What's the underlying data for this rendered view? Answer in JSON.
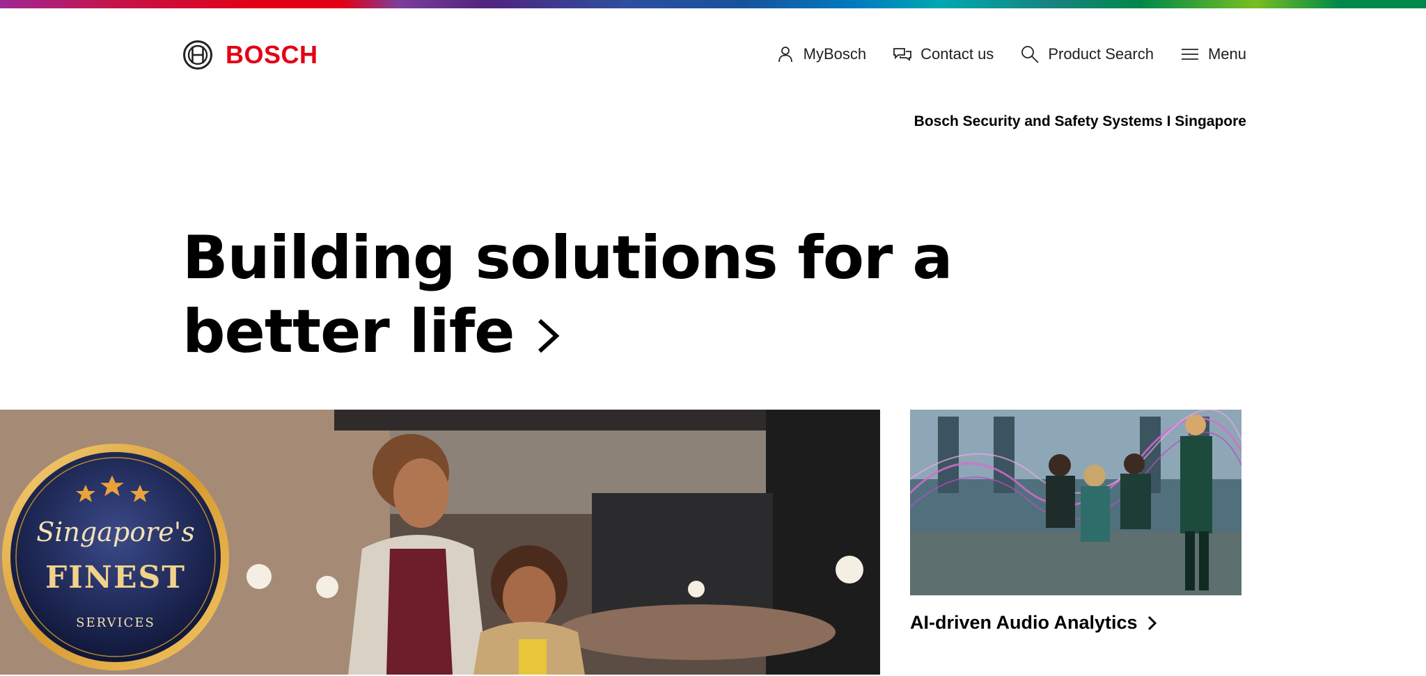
{
  "brand": {
    "logo_text": "BOSCH",
    "logo_color": "#e20015"
  },
  "nav": {
    "items": [
      {
        "label": "MyBosch",
        "icon": "user-icon"
      },
      {
        "label": "Contact us",
        "icon": "chat-icon"
      },
      {
        "label": "Product Search",
        "icon": "search-icon"
      },
      {
        "label": "Menu",
        "icon": "hamburger-icon"
      }
    ]
  },
  "subtitle": "Bosch Security and Safety Systems I Singapore",
  "hero": {
    "title": "Building solutions for a better life"
  },
  "features": [
    {
      "label": "AI-driven Audio Analytics"
    }
  ],
  "badge": {
    "line1": "Singapore's",
    "line2": "FINEST",
    "line3": "SERVICES",
    "star_color": "#e9a33a"
  },
  "colors": {
    "text": "#000000",
    "accent": "#e20015"
  }
}
